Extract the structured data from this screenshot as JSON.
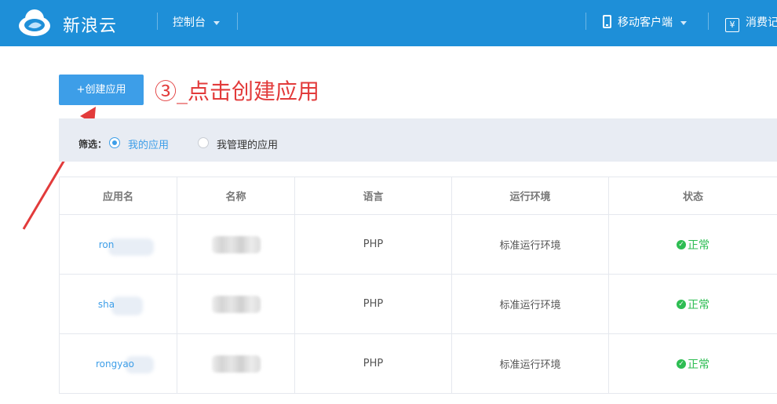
{
  "topbar": {
    "brand": "新浪云",
    "console_label": "控制台",
    "mobile_label": "移动客户端",
    "billing_label": "消费记"
  },
  "create_button": {
    "label": "+创建应用"
  },
  "annotation": {
    "text": "③_点击创建应用"
  },
  "filter": {
    "label": "筛选：",
    "options": [
      {
        "label": "我的应用",
        "selected": true
      },
      {
        "label": "我管理的应用",
        "selected": false
      }
    ]
  },
  "table": {
    "headers": [
      "应用名",
      "名称",
      "语言",
      "运行环境",
      "状态"
    ],
    "rows": [
      {
        "app": "ron",
        "name": "",
        "language": "PHP",
        "env": "标准运行环境",
        "status": "正常"
      },
      {
        "app": "sha",
        "name": "",
        "language": "PHP",
        "env": "标准运行环境",
        "status": "正常"
      },
      {
        "app": "rongyao",
        "name": "",
        "language": "PHP",
        "env": "标准运行环境",
        "status": "正常"
      }
    ]
  },
  "colors": {
    "topbar": "#1e8fd8",
    "accent": "#3d9ee8",
    "annotation": "#e23b3b",
    "status_ok": "#2dbd52"
  },
  "icons": [
    "cloud-logo-icon",
    "chevron-down-icon",
    "phone-icon",
    "yen-icon",
    "check-circle-icon"
  ]
}
